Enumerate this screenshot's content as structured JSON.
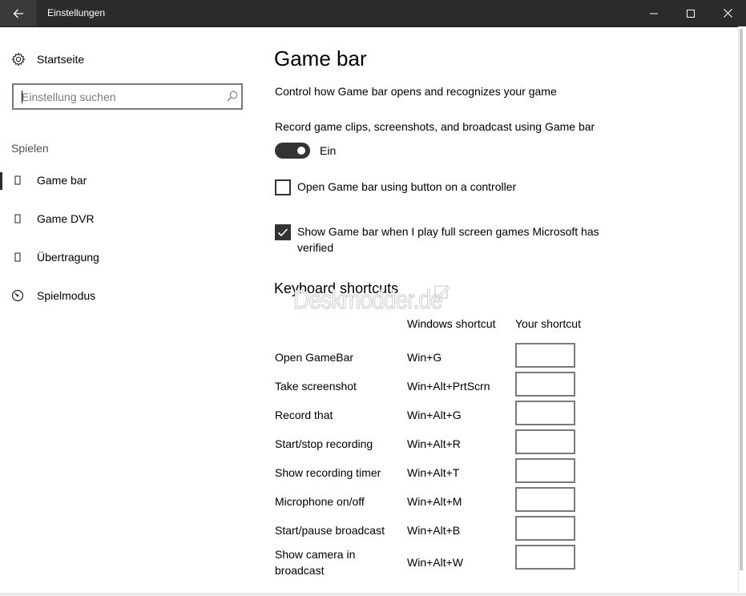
{
  "window": {
    "title": "Einstellungen"
  },
  "sidebar": {
    "home_label": "Startseite",
    "search_placeholder": "Einstellung suchen",
    "section_label": "Spielen",
    "items": [
      {
        "label": "Game bar",
        "icon": "game-bar-icon",
        "selected": true
      },
      {
        "label": "Game DVR",
        "icon": "game-dvr-icon",
        "selected": false
      },
      {
        "label": "Übertragung",
        "icon": "broadcast-icon",
        "selected": false
      },
      {
        "label": "Spielmodus",
        "icon": "game-mode-icon",
        "selected": false
      }
    ]
  },
  "main": {
    "title": "Game bar",
    "subtitle": "Control how Game bar opens and recognizes your game",
    "record_label": "Record game clips, screenshots, and broadcast using Game bar",
    "toggle_state": "Ein",
    "checkbox_controller_label": "Open Game bar using  button on a controller",
    "checkbox_fullscreen_label": "Show Game bar when I play full screen games Microsoft has verified",
    "shortcuts_title": "Keyboard shortcuts",
    "watermark": "Deskmodder.de",
    "col_windows": "Windows shortcut",
    "col_your": "Your shortcut",
    "shortcuts": [
      {
        "action": "Open GameBar",
        "keys": "Win+G"
      },
      {
        "action": "Take screenshot",
        "keys": "Win+Alt+PrtScrn"
      },
      {
        "action": "Record that",
        "keys": "Win+Alt+G"
      },
      {
        "action": "Start/stop recording",
        "keys": "Win+Alt+R"
      },
      {
        "action": "Show recording timer",
        "keys": "Win+Alt+T"
      },
      {
        "action": "Microphone on/off",
        "keys": "Win+Alt+M"
      },
      {
        "action": "Start/pause broadcast",
        "keys": "Win+Alt+B"
      },
      {
        "action": "Show camera in broadcast",
        "keys": "Win+Alt+W"
      }
    ]
  },
  "colors": {
    "titlebar_bg": "#2b2b2b",
    "toggle_on": "#333333",
    "border": "#7a7a7a"
  }
}
